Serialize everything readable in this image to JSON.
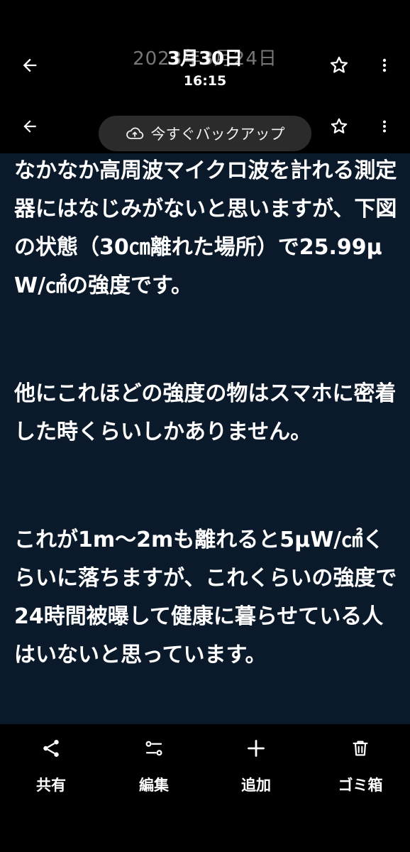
{
  "header": {
    "date_ghost": "2023年3月24日",
    "date": "3月30日",
    "time": "16:15"
  },
  "backup": {
    "label": "今すぐバックアップ"
  },
  "content": {
    "paragraphs": [
      "なかなか高周波マイクロ波を計れる測定器にはなじみがないと思いますが、下図の状態（30㎝離れた場所）で25.99μW/㎠の強度です。",
      "他にこれほどの強度の物はスマホに密着した時くらいしかありません。",
      "これが1m〜2mも離れると5μW/㎠くらいに落ちますが、これくらいの強度で24時間被曝して健康に暮らせている人はいないと思っています。"
    ]
  },
  "actions": {
    "share": "共有",
    "edit": "編集",
    "add": "追加",
    "trash": "ゴミ箱"
  },
  "icons": {
    "back": "back-arrow-icon",
    "favorite": "star-outline-icon",
    "more": "more-vert-icon",
    "cloud": "cloud-upload-icon",
    "share": "share-icon",
    "edit": "sliders-icon",
    "add": "plus-icon",
    "trash": "trash-icon"
  }
}
